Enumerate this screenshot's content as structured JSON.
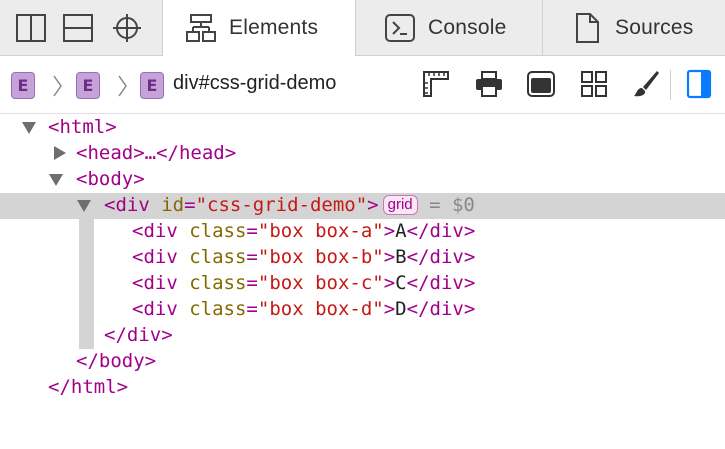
{
  "tabs": [
    {
      "label": "Elements",
      "icon": "elements-icon"
    },
    {
      "label": "Console",
      "icon": "console-icon"
    },
    {
      "label": "Sources",
      "icon": "sources-icon"
    }
  ],
  "left_icons": [
    "dock-side-icon",
    "dock-bottom-icon",
    "inspect-crosshair-icon"
  ],
  "breadcrumb": {
    "badge_letter": "E",
    "current": "div#css-grid-demo"
  },
  "toolbar_icons": [
    "rulers-icon",
    "print-icon",
    "layers-icon",
    "grid-overlay-icon",
    "paintbrush-icon",
    "sidebar-toggle-icon"
  ],
  "dom": {
    "html_open": "<html>",
    "head": "<head>…</head>",
    "body_open": "<body>",
    "div_open_tag": "<div",
    "div_attr_name": "id",
    "div_attr_eq": "=",
    "div_attr_value": "\"css-grid-demo\"",
    "div_open_close": ">",
    "grid_badge": "grid",
    "selected_ref": "= $0",
    "children": [
      {
        "open": "<div",
        "attr": "class",
        "eq": "=",
        "value": "\"box box-a\"",
        "gt": ">",
        "text": "A",
        "close": "</div>"
      },
      {
        "open": "<div",
        "attr": "class",
        "eq": "=",
        "value": "\"box box-b\"",
        "gt": ">",
        "text": "B",
        "close": "</div>"
      },
      {
        "open": "<div",
        "attr": "class",
        "eq": "=",
        "value": "\"box box-c\"",
        "gt": ">",
        "text": "C",
        "close": "</div>"
      },
      {
        "open": "<div",
        "attr": "class",
        "eq": "=",
        "value": "\"box box-d\"",
        "gt": ">",
        "text": "D",
        "close": "</div>"
      }
    ],
    "div_close": "</div>",
    "body_close": "</body>",
    "html_close": "</html>"
  },
  "colors": {
    "tag": "#a1008a",
    "attr": "#826b00",
    "value": "#c41a16",
    "accent_blue": "#0a7aff",
    "badge_purple": "#c5a3d8"
  }
}
